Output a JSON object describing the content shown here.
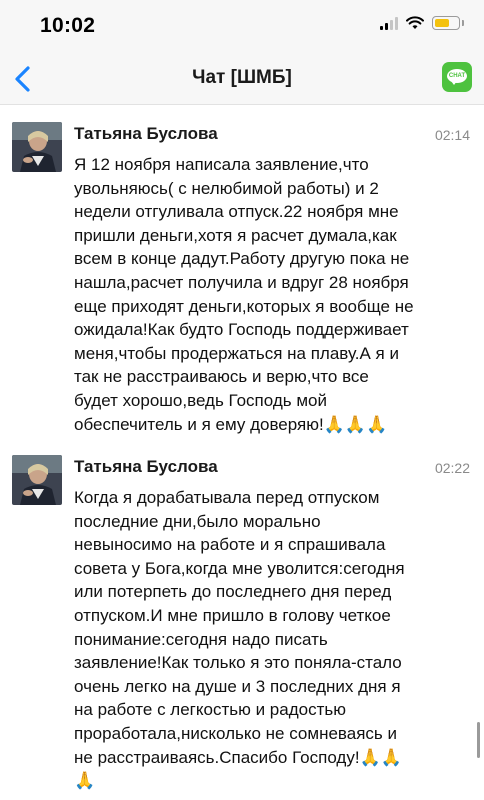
{
  "status_bar": {
    "time": "10:02",
    "signal_icon": "cellular-signal-icon",
    "wifi_icon": "wifi-icon",
    "battery_icon": "battery-icon",
    "battery_color": "#f4c20d"
  },
  "nav": {
    "back_icon": "chevron-left-icon",
    "title": "Чат [ШМБ]",
    "chat_button_label": "CHAT",
    "accent_color": "#1a84ff",
    "chat_color": "#4ec23f"
  },
  "messages": [
    {
      "sender": "Татьяна Буслова",
      "time": "02:14",
      "text": "Я 12 ноября написала заявление,что\nувольняюсь( с нелюбимой работы) и 2\nнедели  отгуливала отпуск.22 ноября мне\nпришли деньги,хотя я расчет думала,как\nвсем в конце дадут.Работу другую пока не\nнашла,расчет получила и вдруг 28 ноября\nеще приходят деньги,которых я вообще не\nожидала!Как будто Господь поддерживает\nменя,чтобы продержаться на плаву.А я и\nтак не расстраиваюсь и верю,что все\nбудет хорошо,ведь Господь мой\nобеспечитель и я ему доверяю!🙏🙏🙏"
    },
    {
      "sender": "Татьяна Буслова",
      "time": "02:22",
      "text": "Когда я дорабатывала перед отпуском\nпоследние дни,было морально\nневыносимо на работе и я спрашивала\nсовета у Бога,когда мне уволится:сегодня\nили потерпеть до последнего дня перед\nотпуском.И мне пришло в голову четкое\nпонимание:сегодня надо писать\nзаявление!Как только я это поняла-стало\nочень легко на душе и 3 последних дня я\nна работе с легкостью и радостью\nпроработала,нисколько не сомневаясь и\nне расстраиваясь.Спасибо Господу!🙏🙏\n🙏"
    }
  ]
}
